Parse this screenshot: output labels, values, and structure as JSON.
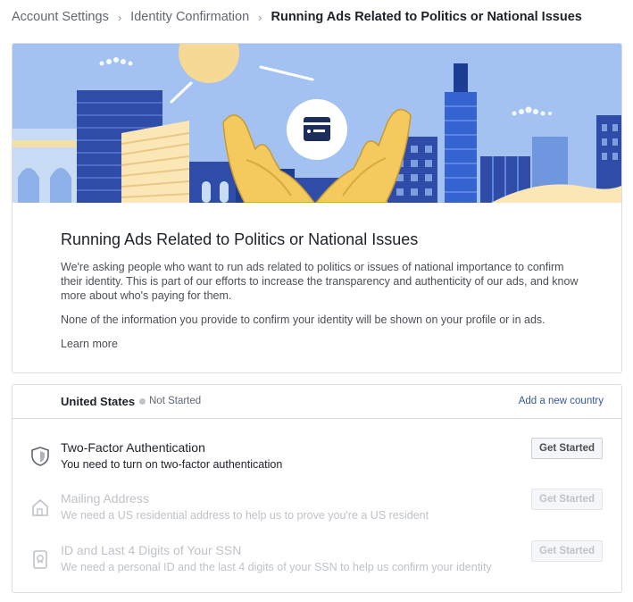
{
  "breadcrumb": {
    "items": [
      "Account Settings",
      "Identity Confirmation"
    ],
    "current": "Running Ads Related to Politics or National Issues"
  },
  "intro": {
    "title": "Running Ads Related to Politics or National Issues",
    "paragraph1": "We're asking people who want to run ads related to politics or issues of national importance to confirm their identity. This is part of our efforts to increase the transparency and authenticity of our ads, and know more about who's paying for them.",
    "paragraph2": "None of the information you provide to confirm your identity will be shown on your profile or in ads.",
    "learn_more": "Learn more"
  },
  "steps_card": {
    "country": "United States",
    "status": "Not Started",
    "add_country": "Add a new country",
    "steps": [
      {
        "title": "Two-Factor Authentication",
        "description": "You need to turn on two-factor authentication",
        "button": "Get Started",
        "enabled": true,
        "icon": "shield-icon"
      },
      {
        "title": "Mailing Address",
        "description": "We need a US residential address to help us to prove you're a US resident",
        "button": "Get Started",
        "enabled": false,
        "icon": "house-icon"
      },
      {
        "title": "ID and Last 4 Digits of Your SSN",
        "description": "We need a personal ID and the last 4 digits of your SSN to help us confirm your identity",
        "button": "Get Started",
        "enabled": false,
        "icon": "id-card-icon"
      }
    ]
  },
  "colors": {
    "sky": "#a3c2f2",
    "sun": "#f7d996",
    "building_dark": "#2f4da8",
    "hands": "#f4c95d",
    "link": "#365899",
    "disabled_text": "#bec3c9"
  }
}
